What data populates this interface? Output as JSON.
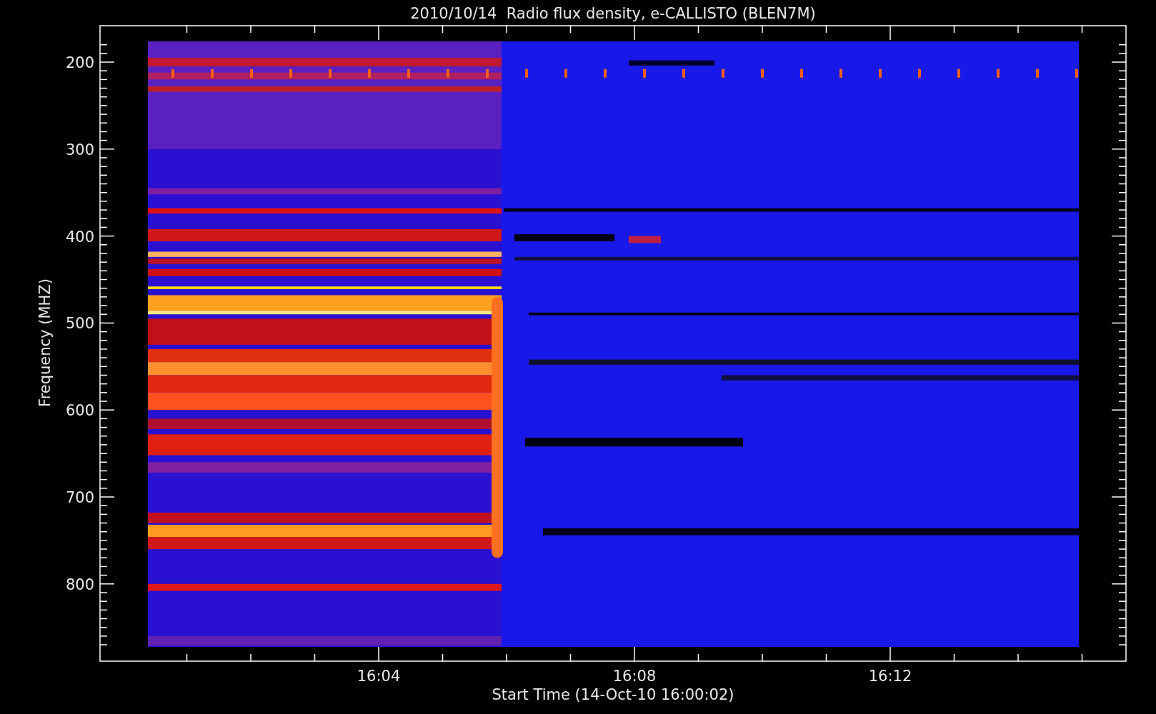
{
  "title": "2010/10/14  Radio flux density, e-CALLISTO (BLEN7M)",
  "y_axis": {
    "label": "Frequency (MHZ)",
    "ticks": [
      "200",
      "300",
      "400",
      "500",
      "600",
      "700",
      "800"
    ]
  },
  "x_axis": {
    "label": "Start Time (14-Oct-10 16:00:02)",
    "ticks": [
      "16:04",
      "16:08",
      "16:12"
    ]
  }
}
